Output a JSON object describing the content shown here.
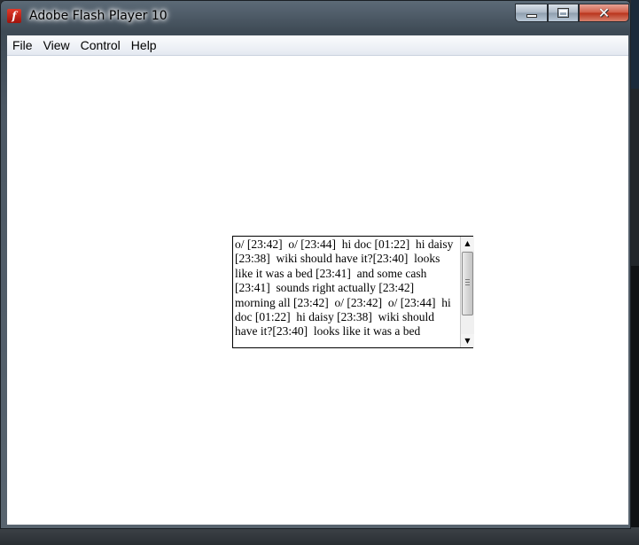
{
  "window": {
    "title": "Adobe Flash Player 10",
    "app_icon": "flash-player-icon",
    "controls": {
      "minimize_icon": "minimize-icon",
      "maximize_icon": "maximize-icon",
      "close_icon": "close-icon"
    }
  },
  "menu": {
    "items": [
      {
        "label": "File"
      },
      {
        "label": "View"
      },
      {
        "label": "Control"
      },
      {
        "label": "Help"
      }
    ]
  },
  "chat": {
    "text": "o/ [23:42]  o/ [23:44]  hi doc [01:22]  hi daisy [23:38]  wiki should have it?[23:40]  looks like it was a bed [23:41]  and some cash [23:41]  sounds right actually [23:42]  morning all [23:42]  o/ [23:42]  o/ [23:44]  hi doc [01:22]  hi daisy [23:38]  wiki should have it?[23:40]  looks like it was a bed",
    "scroll": {
      "up_icon": "scroll-up-arrow-icon",
      "down_icon": "scroll-down-arrow-icon",
      "thumb_grip_icon": "grip-icon"
    }
  },
  "colors": {
    "frame": "#4b5763",
    "close_button": "#c94a33",
    "client_background": "#ffffff"
  }
}
